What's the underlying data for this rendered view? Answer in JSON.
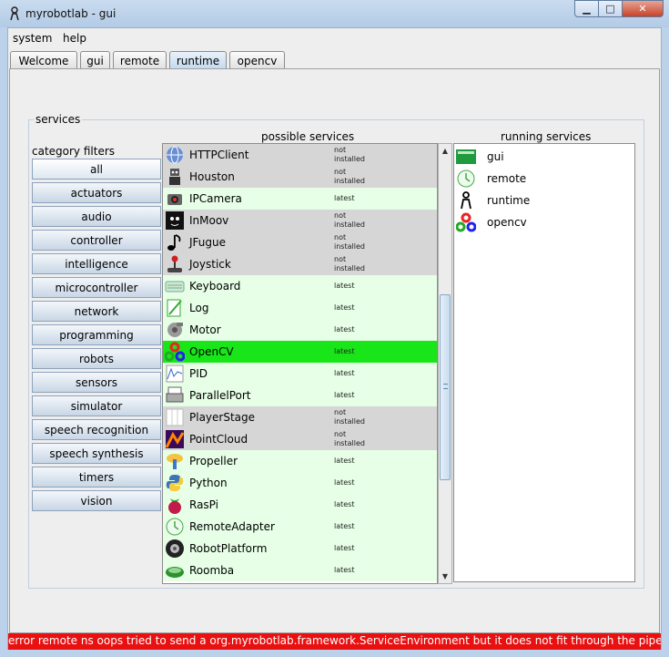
{
  "window": {
    "title": "myrobotlab - gui",
    "minimize_glyph": "▁",
    "maximize_glyph": "□",
    "close_glyph": "✕"
  },
  "menu": [
    "system",
    "help"
  ],
  "tabs": [
    "Welcome",
    "gui",
    "remote",
    "runtime",
    "opencv"
  ],
  "active_tab": "runtime",
  "services": {
    "legend": "services",
    "category_filters_label": "category filters",
    "possible_label": "possible services",
    "running_label": "running services",
    "filters": [
      "all",
      "actuators",
      "audio",
      "controller",
      "intelligence",
      "microcontroller",
      "network",
      "programming",
      "robots",
      "sensors",
      "simulator",
      "speech recognition",
      "speech synthesis",
      "timers",
      "vision"
    ],
    "selected_filter": "all",
    "possible": [
      {
        "name": "HTTPClient",
        "status": [
          "not",
          "installed"
        ],
        "state": "ni",
        "icon": "globe-icon"
      },
      {
        "name": "Houston",
        "status": [
          "not",
          "installed"
        ],
        "state": "ni",
        "icon": "robot-icon"
      },
      {
        "name": "IPCamera",
        "status": [
          "latest"
        ],
        "state": "lat",
        "icon": "camera-icon"
      },
      {
        "name": "InMoov",
        "status": [
          "not",
          "installed"
        ],
        "state": "ni",
        "icon": "face-icon"
      },
      {
        "name": "JFugue",
        "status": [
          "not",
          "installed"
        ],
        "state": "ni",
        "icon": "music-note-icon"
      },
      {
        "name": "Joystick",
        "status": [
          "not",
          "installed"
        ],
        "state": "ni",
        "icon": "joystick-icon"
      },
      {
        "name": "Keyboard",
        "status": [
          "latest"
        ],
        "state": "lat",
        "icon": "keyboard-icon"
      },
      {
        "name": "Log",
        "status": [
          "latest"
        ],
        "state": "lat",
        "icon": "log-icon"
      },
      {
        "name": "Motor",
        "status": [
          "latest"
        ],
        "state": "lat",
        "icon": "motor-icon"
      },
      {
        "name": "OpenCV",
        "status": [
          "latest"
        ],
        "state": "sel",
        "icon": "opencv-icon"
      },
      {
        "name": "PID",
        "status": [
          "latest"
        ],
        "state": "lat",
        "icon": "pid-graph-icon"
      },
      {
        "name": "ParallelPort",
        "status": [
          "latest"
        ],
        "state": "lat",
        "icon": "printer-icon"
      },
      {
        "name": "PlayerStage",
        "status": [
          "not",
          "installed"
        ],
        "state": "ni",
        "icon": "stage-icon"
      },
      {
        "name": "PointCloud",
        "status": [
          "not",
          "installed"
        ],
        "state": "ni",
        "icon": "point-cloud-icon"
      },
      {
        "name": "Propeller",
        "status": [
          "latest"
        ],
        "state": "lat",
        "icon": "propeller-icon"
      },
      {
        "name": "Python",
        "status": [
          "latest"
        ],
        "state": "lat",
        "icon": "python-icon"
      },
      {
        "name": "RasPi",
        "status": [
          "latest"
        ],
        "state": "lat",
        "icon": "raspberry-icon"
      },
      {
        "name": "RemoteAdapter",
        "status": [
          "latest"
        ],
        "state": "lat",
        "icon": "remote-adapter-icon"
      },
      {
        "name": "RobotPlatform",
        "status": [
          "latest"
        ],
        "state": "lat",
        "icon": "wheel-icon"
      },
      {
        "name": "Roomba",
        "status": [
          "latest"
        ],
        "state": "lat",
        "icon": "roomba-icon"
      }
    ],
    "running": [
      {
        "name": "gui",
        "icon": "gui-icon"
      },
      {
        "name": "remote",
        "icon": "remote-icon"
      },
      {
        "name": "runtime",
        "icon": "runtime-icon"
      },
      {
        "name": "opencv",
        "icon": "opencv-icon"
      }
    ]
  },
  "status_message": "error remote ns oops tried to send a org.myrobotlab.framework.ServiceEnvironment but it does not fit through the pipe",
  "colors": {
    "selected_row": "#19e619",
    "latest_row": "#e6ffe6",
    "not_installed_row": "#d6d6d6",
    "error_bar": "#e81010"
  }
}
